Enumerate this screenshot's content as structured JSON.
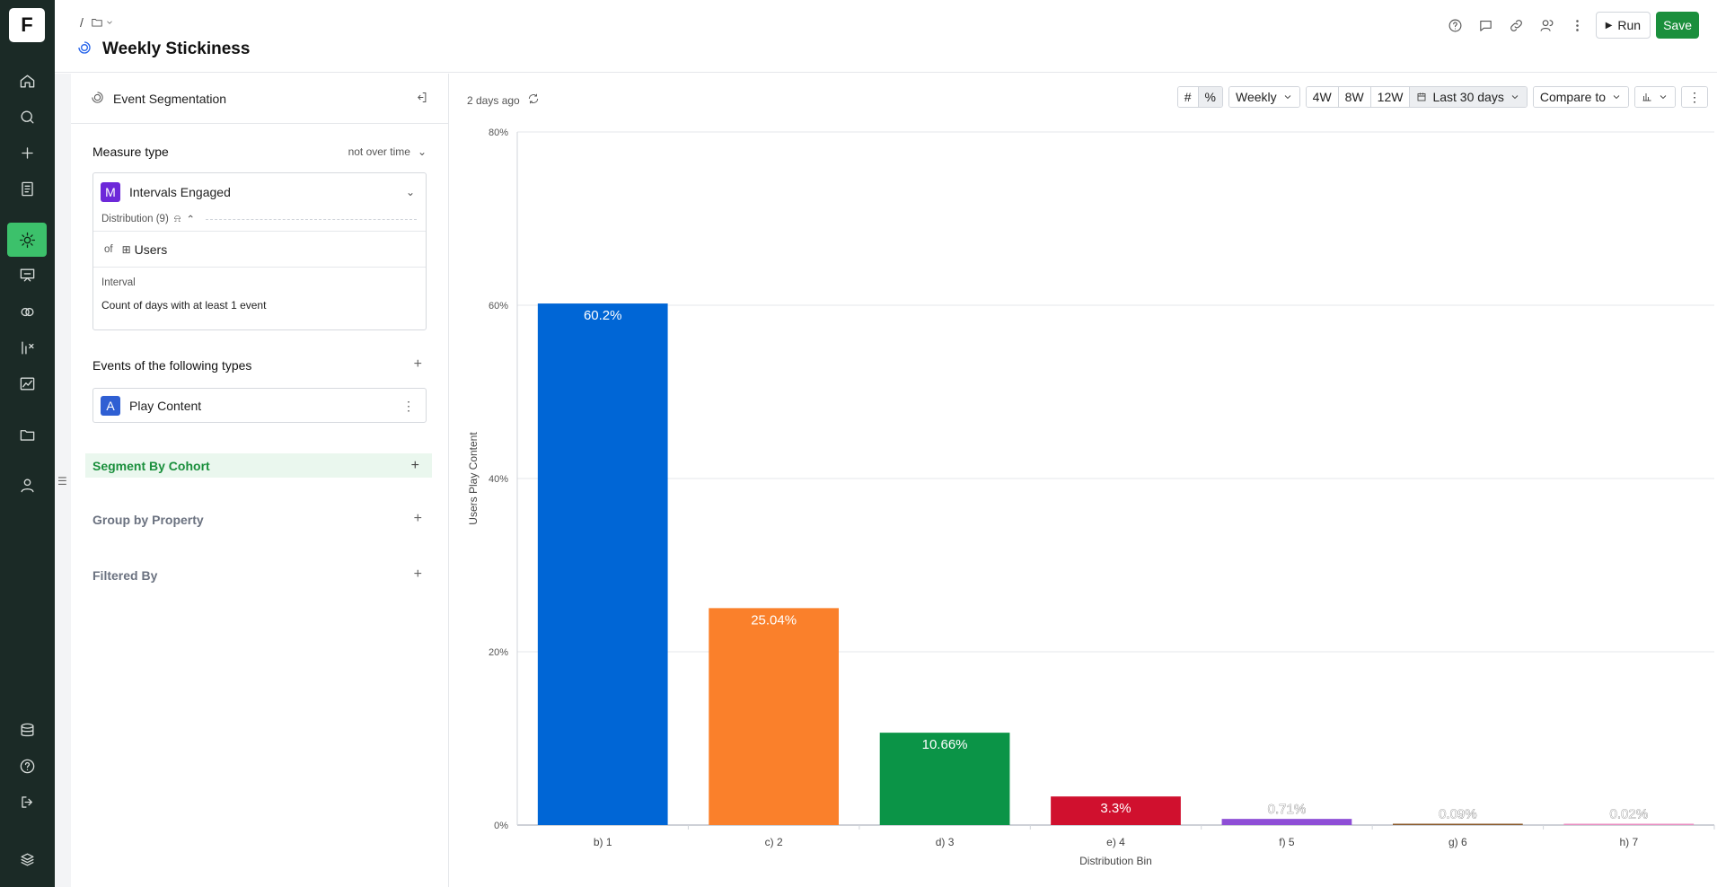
{
  "app": {
    "logo": "F"
  },
  "rail": {
    "items": [
      {
        "name": "home-icon"
      },
      {
        "name": "search-icon"
      },
      {
        "name": "plus-icon"
      },
      {
        "name": "notebook-icon"
      },
      {
        "name": "insights-icon",
        "active": true
      },
      {
        "name": "presentation-icon"
      },
      {
        "name": "cohorts-icon"
      },
      {
        "name": "metrics-icon"
      },
      {
        "name": "dashboard-icon"
      },
      {
        "name": "folder-icon"
      },
      {
        "name": "user-icon"
      }
    ],
    "bottom": [
      {
        "name": "data-icon"
      },
      {
        "name": "help-icon"
      },
      {
        "name": "logout-icon"
      },
      {
        "name": "brand-icon"
      }
    ]
  },
  "header": {
    "breadcrumb_sep": "/",
    "title": "Weekly Stickiness",
    "run_label": "Run",
    "save_label": "Save"
  },
  "panel": {
    "title": "Event Segmentation",
    "measure": {
      "label": "Measure type",
      "mode": "not over time",
      "metric_badge": "M",
      "metric": "Intervals Engaged",
      "distribution": "Distribution (9)",
      "of_label": "of",
      "of_value": "Users",
      "interval_label": "Interval",
      "interval_value": "Count of days with at least 1 event"
    },
    "events": {
      "label": "Events of the following types",
      "badge": "A",
      "event": "Play Content"
    },
    "segment_by": "Segment By Cohort",
    "group_by": "Group by Property",
    "filtered_by": "Filtered By",
    "plus": "+"
  },
  "main": {
    "updated": "2 days ago",
    "toolbar": {
      "interval": "Weekly",
      "ranges": [
        "4W",
        "8W",
        "12W"
      ],
      "date_range": "Last 30 days",
      "compare": "Compare to"
    }
  },
  "chart_data": {
    "type": "bar",
    "categories": [
      "b) 1",
      "c) 2",
      "d) 3",
      "e) 4",
      "f) 5",
      "g) 6",
      "h) 7"
    ],
    "values": [
      60.2,
      25.04,
      10.66,
      3.3,
      0.71,
      0.09,
      0.02
    ],
    "labels": [
      "60.2%",
      "25.04%",
      "10.66%",
      "3.3%",
      "0.71%",
      "0.09%",
      "0.02%"
    ],
    "colors": [
      "#0066d6",
      "#fa802b",
      "#0b9447",
      "#d0102e",
      "#8e4ed6",
      "#8a5a2c",
      "#ea8fc2"
    ],
    "xlabel": "Distribution Bin",
    "ylabel": "Users Play Content",
    "ylim": [
      0,
      80
    ],
    "yticks": [
      "0%",
      "20%",
      "40%",
      "60%",
      "80%"
    ],
    "grid": true
  }
}
